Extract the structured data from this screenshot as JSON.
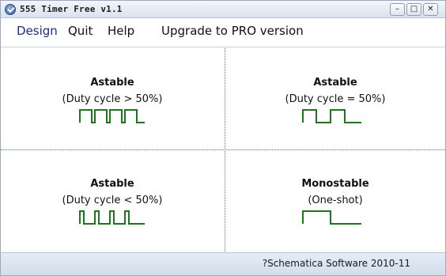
{
  "window": {
    "title": "555 Timer Free v1.1",
    "controls": {
      "minimize": "–",
      "maximize": "□",
      "close": "✕"
    }
  },
  "menu": {
    "design": "Design",
    "quit": "Quit",
    "help": "Help",
    "upgrade": "Upgrade to PRO version"
  },
  "cells": [
    {
      "title": "Astable",
      "subtitle": "(Duty cycle > 50%)",
      "icon": "square-wave-high-duty"
    },
    {
      "title": "Astable",
      "subtitle": "(Duty cycle = 50%)",
      "icon": "square-wave-50-duty"
    },
    {
      "title": "Astable",
      "subtitle": "(Duty cycle < 50%)",
      "icon": "square-wave-low-duty"
    },
    {
      "title": "Monostable",
      "subtitle": "(One-shot)",
      "icon": "single-pulse"
    }
  ],
  "status": {
    "text": "?Schematica Software 2010-11"
  },
  "colors": {
    "wave": "#1a7a1a",
    "divider": "#5b6fae",
    "menu_accent": "#1b2f8a"
  }
}
